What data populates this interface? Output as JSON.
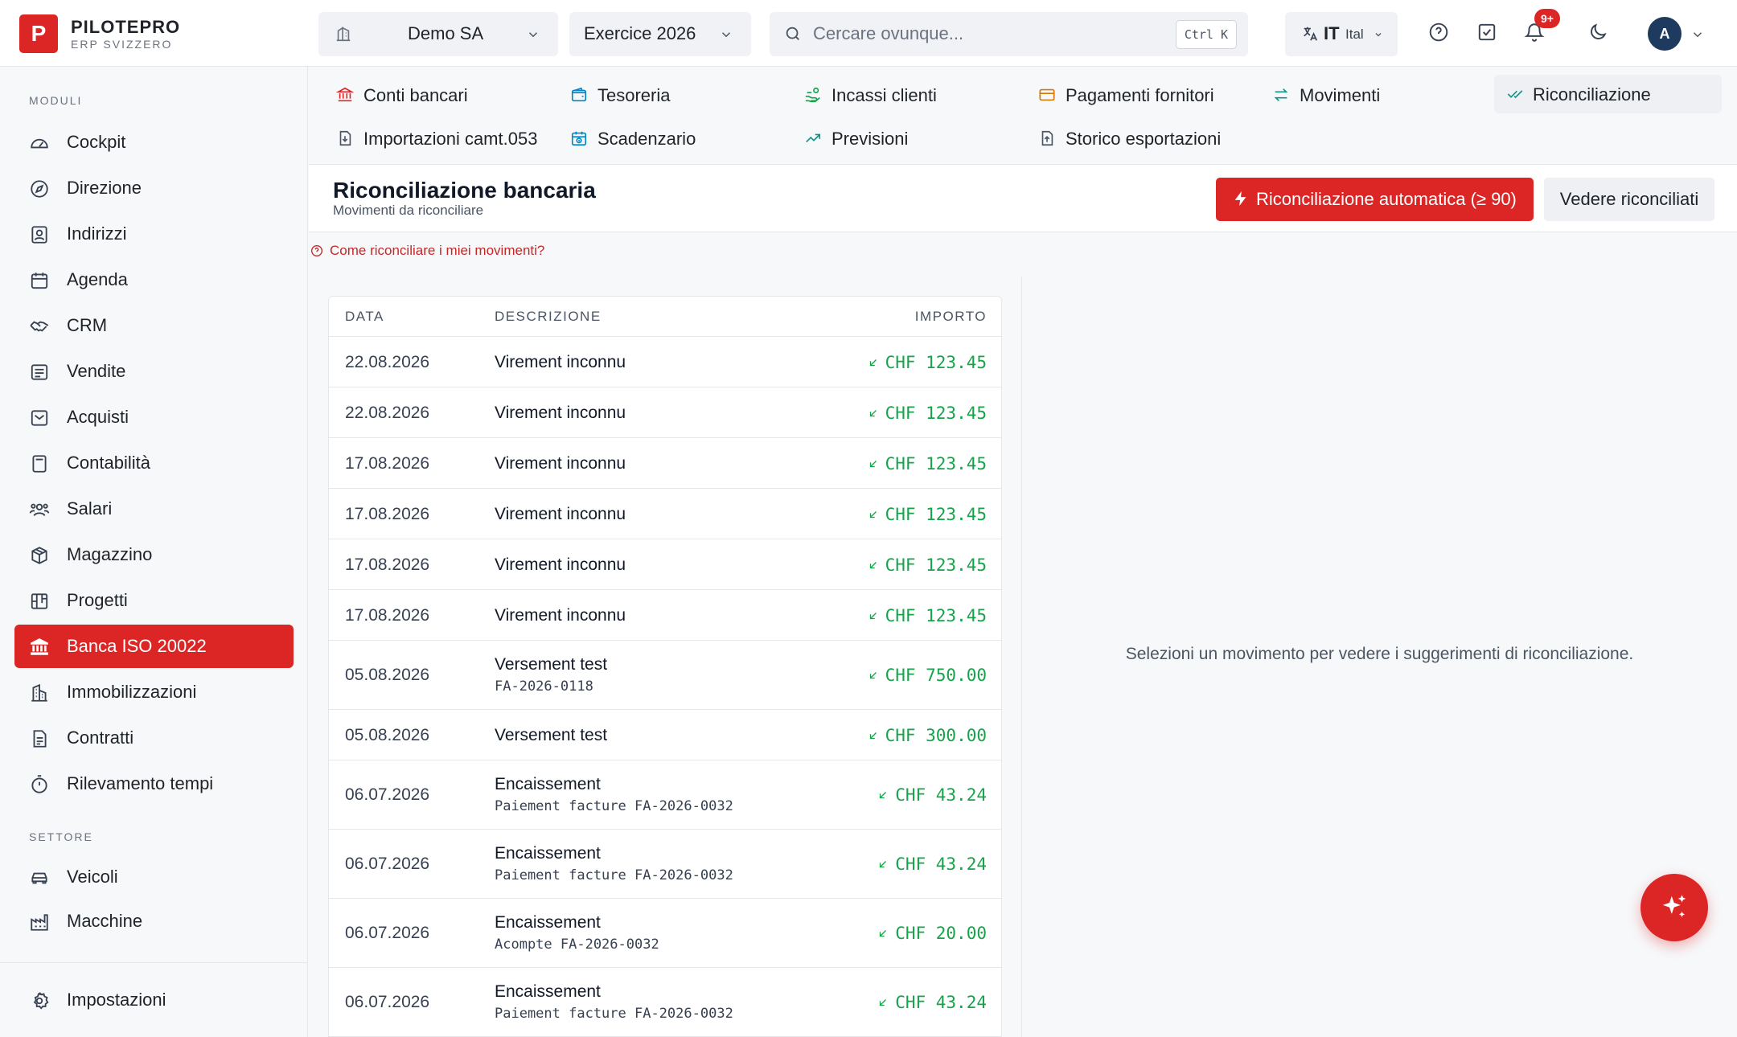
{
  "brand": {
    "logo_letter": "P",
    "name": "PILOTEPRO",
    "subtitle": "ERP SVIZZERO"
  },
  "header": {
    "company": "Demo SA",
    "fiscal_year": "Exercice 2026",
    "search_placeholder": "Cercare ovunque...",
    "search_shortcut": "Ctrl K",
    "language_code": "IT",
    "language_name": "Ital",
    "notifications_badge": "9+",
    "avatar_initial": "A",
    "icons": [
      "building-icon",
      "search-icon",
      "translate-icon",
      "help-circle-icon",
      "checkbox-icon",
      "bell-icon",
      "moon-icon"
    ]
  },
  "sidebar": {
    "modules_heading": "MODULI",
    "items": [
      {
        "label": "Cockpit",
        "icon": "gauge-icon"
      },
      {
        "label": "Direzione",
        "icon": "compass-icon"
      },
      {
        "label": "Indirizzi",
        "icon": "contact-icon"
      },
      {
        "label": "Agenda",
        "icon": "calendar-icon"
      },
      {
        "label": "CRM",
        "icon": "handshake-icon"
      },
      {
        "label": "Vendite",
        "icon": "receipt-icon"
      },
      {
        "label": "Acquisti",
        "icon": "inbox-icon"
      },
      {
        "label": "Contabilità",
        "icon": "calculator-icon"
      },
      {
        "label": "Salari",
        "icon": "users-icon"
      },
      {
        "label": "Magazzino",
        "icon": "box-icon"
      },
      {
        "label": "Progetti",
        "icon": "kanban-icon"
      },
      {
        "label": "Banca ISO 20022",
        "icon": "bank-icon",
        "active": true
      },
      {
        "label": "Immobilizzazioni",
        "icon": "buildings-icon"
      },
      {
        "label": "Contratti",
        "icon": "contract-icon"
      },
      {
        "label": "Rilevamento tempi",
        "icon": "timer-icon"
      }
    ],
    "sector_heading": "SETTORE",
    "sector_items": [
      {
        "label": "Veicoli",
        "icon": "car-icon"
      },
      {
        "label": "Macchine",
        "icon": "factory-icon"
      }
    ],
    "settings_label": "Impostazioni"
  },
  "tabs": [
    {
      "label": "Conti bancari",
      "icon": "bank-icon",
      "color": "#dc2626"
    },
    {
      "label": "Tesoreria",
      "icon": "wallet-icon",
      "color": "#0284c7"
    },
    {
      "label": "Incassi clienti",
      "icon": "hand-coins-icon",
      "color": "#16a34a"
    },
    {
      "label": "Pagamenti fornitori",
      "icon": "credit-card-icon",
      "color": "#d97706"
    },
    {
      "label": "Movimenti",
      "icon": "arrows-swap-icon",
      "color": "#0d9488"
    },
    {
      "label": "Riconciliazione",
      "icon": "check-check-icon",
      "color": "#0d9488",
      "active": true
    },
    {
      "label": "Importazioni camt.053",
      "icon": "file-import-icon",
      "color": "#4b5563"
    },
    {
      "label": "Scadenzario",
      "icon": "calendar-clock-icon",
      "color": "#0284c7"
    },
    {
      "label": "Previsioni",
      "icon": "trending-up-icon",
      "color": "#0d9488"
    },
    {
      "label": "Storico esportazioni",
      "icon": "file-export-icon",
      "color": "#4b5563"
    }
  ],
  "page": {
    "title": "Riconciliazione bancaria",
    "subtitle": "Movimenti da riconciliare",
    "auto_button": "Riconciliazione automatica (≥ 90)",
    "seen_button": "Vedere riconciliati",
    "help_link": "Come riconciliare i miei movimenti?",
    "empty_message": "Selezioni un movimento per vedere i suggerimenti di riconciliazione.",
    "accent_color": "#dc2626",
    "amount_color": "#16a34a"
  },
  "table": {
    "headers": {
      "date": "DATA",
      "description": "DESCRIZIONE",
      "amount": "IMPORTO"
    },
    "rows": [
      {
        "date": "22.08.2026",
        "description": "Virement inconnu",
        "reference": "",
        "amount": "CHF 123.45"
      },
      {
        "date": "22.08.2026",
        "description": "Virement inconnu",
        "reference": "",
        "amount": "CHF 123.45"
      },
      {
        "date": "17.08.2026",
        "description": "Virement inconnu",
        "reference": "",
        "amount": "CHF 123.45"
      },
      {
        "date": "17.08.2026",
        "description": "Virement inconnu",
        "reference": "",
        "amount": "CHF 123.45"
      },
      {
        "date": "17.08.2026",
        "description": "Virement inconnu",
        "reference": "",
        "amount": "CHF 123.45"
      },
      {
        "date": "17.08.2026",
        "description": "Virement inconnu",
        "reference": "",
        "amount": "CHF 123.45"
      },
      {
        "date": "05.08.2026",
        "description": "Versement test",
        "reference": "FA-2026-0118",
        "amount": "CHF 750.00"
      },
      {
        "date": "05.08.2026",
        "description": "Versement test",
        "reference": "",
        "amount": "CHF 300.00"
      },
      {
        "date": "06.07.2026",
        "description": "Encaissement",
        "reference": "Paiement facture FA-2026-0032",
        "amount": "CHF 43.24"
      },
      {
        "date": "06.07.2026",
        "description": "Encaissement",
        "reference": "Paiement facture FA-2026-0032",
        "amount": "CHF 43.24"
      },
      {
        "date": "06.07.2026",
        "description": "Encaissement",
        "reference": "Acompte FA-2026-0032",
        "amount": "CHF 20.00"
      },
      {
        "date": "06.07.2026",
        "description": "Encaissement",
        "reference": "Paiement facture FA-2026-0032",
        "amount": "CHF 43.24"
      }
    ]
  }
}
